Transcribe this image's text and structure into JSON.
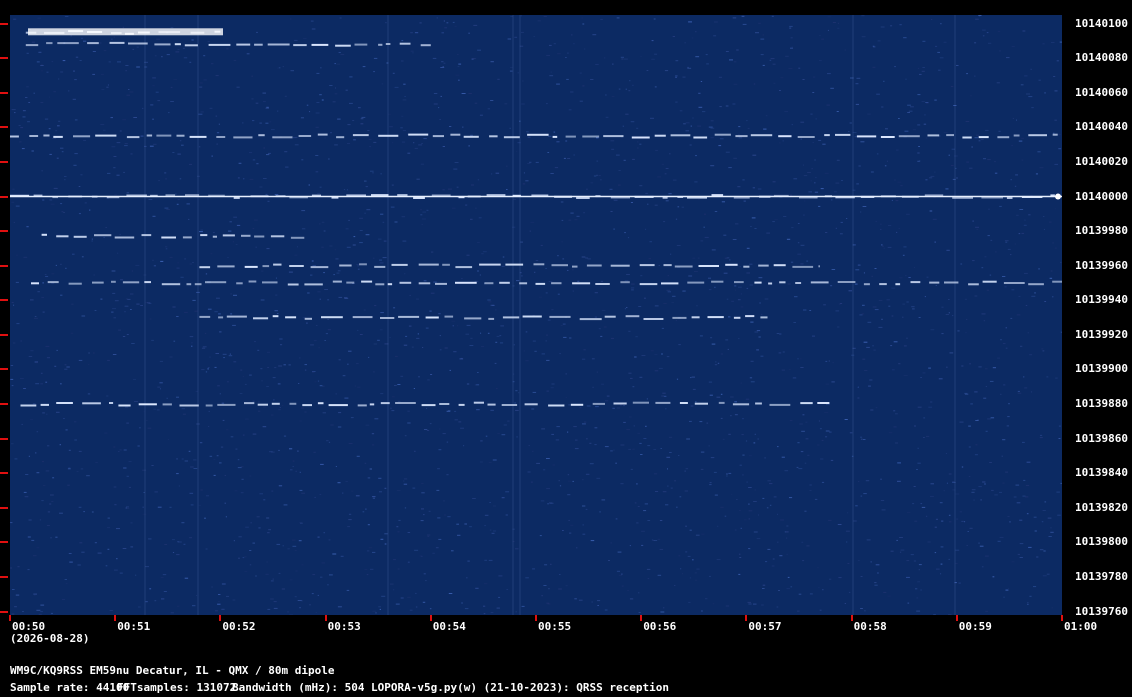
{
  "chart_data": {
    "type": "heatmap",
    "y_ticks": [
      "10140100",
      "10140080",
      "10140060",
      "10140040",
      "10140020",
      "10140000",
      "10139980",
      "10139960",
      "10139940",
      "10139920",
      "10139900",
      "10139880",
      "10139860",
      "10139840",
      "10139820",
      "10139800",
      "10139780",
      "10139760"
    ],
    "x_ticks": [
      "00:50",
      "00:51",
      "00:52",
      "00:53",
      "00:54",
      "00:55",
      "00:56",
      "00:57",
      "00:58",
      "00:59",
      "01:00"
    ],
    "date_label": "(2026-08-28)",
    "traces": [
      {
        "name": "",
        "freq": 10140095,
        "start_min": 0.15,
        "end_min": 2.0
      },
      {
        "name": "",
        "freq": 10140088,
        "start_min": 0.15,
        "end_min": 4.0
      },
      {
        "name": "",
        "freq": 10140035,
        "start_min": 0.0,
        "end_min": 10.0
      },
      {
        "name": "",
        "freq": 10140000,
        "start_min": 0.0,
        "end_min": 10.0
      },
      {
        "name": "",
        "freq": 10139977,
        "start_min": 0.3,
        "end_min": 2.8
      },
      {
        "name": "",
        "freq": 10139960,
        "start_min": 1.8,
        "end_min": 7.7
      },
      {
        "name": "",
        "freq": 10139950,
        "start_min": 0.2,
        "end_min": 10.0
      },
      {
        "name": "",
        "freq": 10139930,
        "start_min": 1.8,
        "end_min": 7.2
      },
      {
        "name": "",
        "freq": 10139880,
        "start_min": 0.1,
        "end_min": 7.8
      }
    ]
  },
  "footer": {
    "station": "WM9C/KQ9RSS EM59nu Decatur, IL - QMX / 80m dipole",
    "sample_rate": "Sample rate: 44100",
    "fft_samples": "FFTsamples: 131072",
    "bandwidth": "Bandwidth (mHz): 504",
    "software": "LOPORA-v5g.py(w) (21-10-2023): QRSS reception"
  },
  "colors": {
    "background": "#0c2a63",
    "tick": "#e01010",
    "trace": "#dce8ff"
  }
}
